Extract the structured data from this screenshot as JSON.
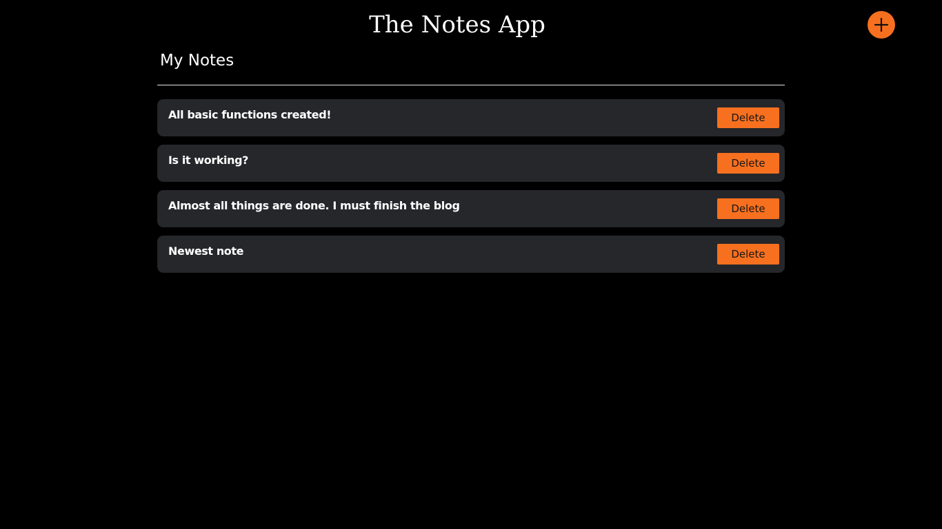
{
  "app": {
    "title": "The Notes App",
    "add_button_icon": "plus-icon",
    "accent_color": "#f7701f",
    "background_color": "#000000",
    "card_color": "#26272b"
  },
  "section": {
    "title": "My Notes"
  },
  "notes": [
    {
      "text": "All basic functions created!",
      "delete_label": "Delete"
    },
    {
      "text": "Is it working?",
      "delete_label": "Delete"
    },
    {
      "text": "Almost all things are done. I must finish the blog",
      "delete_label": "Delete"
    },
    {
      "text": "Newest note",
      "delete_label": "Delete"
    }
  ]
}
